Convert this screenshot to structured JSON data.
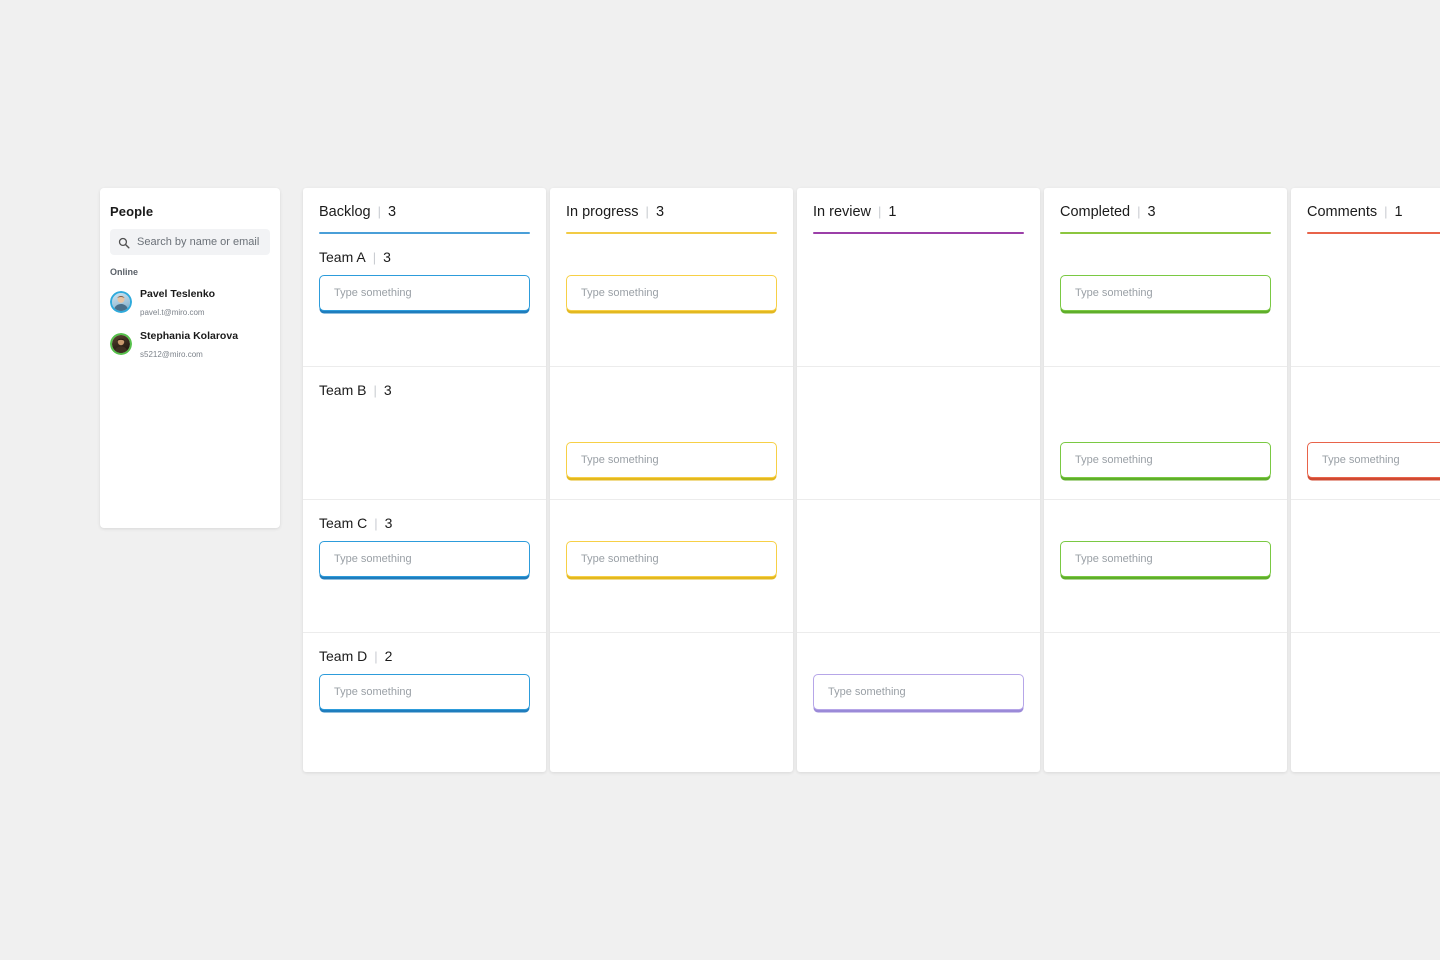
{
  "sidebar": {
    "title": "People",
    "search": {
      "placeholder": "Search by name or email",
      "icon": "search-icon",
      "value": ""
    },
    "group_label": "Online",
    "people": [
      {
        "name": "Pavel Teslenko",
        "email": "pavel.t@miro.com",
        "ring_color": "#2eaadc",
        "avatar_bg": "#bcd6e6"
      },
      {
        "name": "Stephania Kolarova",
        "email": "s5212@miro.com",
        "ring_color": "#56c14b",
        "avatar_bg": "#3a2a1e"
      }
    ]
  },
  "board": {
    "row_labels": [
      {
        "label": "Team A",
        "separator": "|",
        "count": "3"
      },
      {
        "label": "Team B",
        "separator": "|",
        "count": "3"
      },
      {
        "label": "Team C",
        "separator": "|",
        "count": "3"
      },
      {
        "label": "Team D",
        "separator": "|",
        "count": "2"
      }
    ],
    "card_placeholder": "Type something",
    "add_icon": "plus-icon",
    "columns": [
      {
        "title": "Backlog",
        "separator": "|",
        "count": "3",
        "accent": "#4a9fd8",
        "card_border": "#2d9cdb",
        "card_shadow": "#1f7dbd",
        "cells": [
          true,
          false,
          true,
          true
        ]
      },
      {
        "title": "In progress",
        "separator": "|",
        "count": "3",
        "accent": "#f2cb45",
        "card_border": "#f7d046",
        "card_shadow": "#e3b81f",
        "cells": [
          true,
          true,
          true,
          false
        ]
      },
      {
        "title": "In review",
        "separator": "|",
        "count": "1",
        "accent": "#9b3fa8",
        "card_border": "#b6a6e8",
        "card_shadow": "#9b8ad8",
        "cells": [
          false,
          false,
          false,
          true
        ]
      },
      {
        "title": "Completed",
        "separator": "|",
        "count": "3",
        "accent": "#8cc63f",
        "card_border": "#7ac943",
        "card_shadow": "#5fae2a",
        "cells": [
          true,
          true,
          true,
          false
        ]
      },
      {
        "title": "Comments",
        "separator": "|",
        "count": "1",
        "accent": "#e8634a",
        "card_border": "#e8634a",
        "card_shadow": "#cf4a32",
        "cells": [
          false,
          true,
          false,
          false
        ]
      }
    ]
  }
}
